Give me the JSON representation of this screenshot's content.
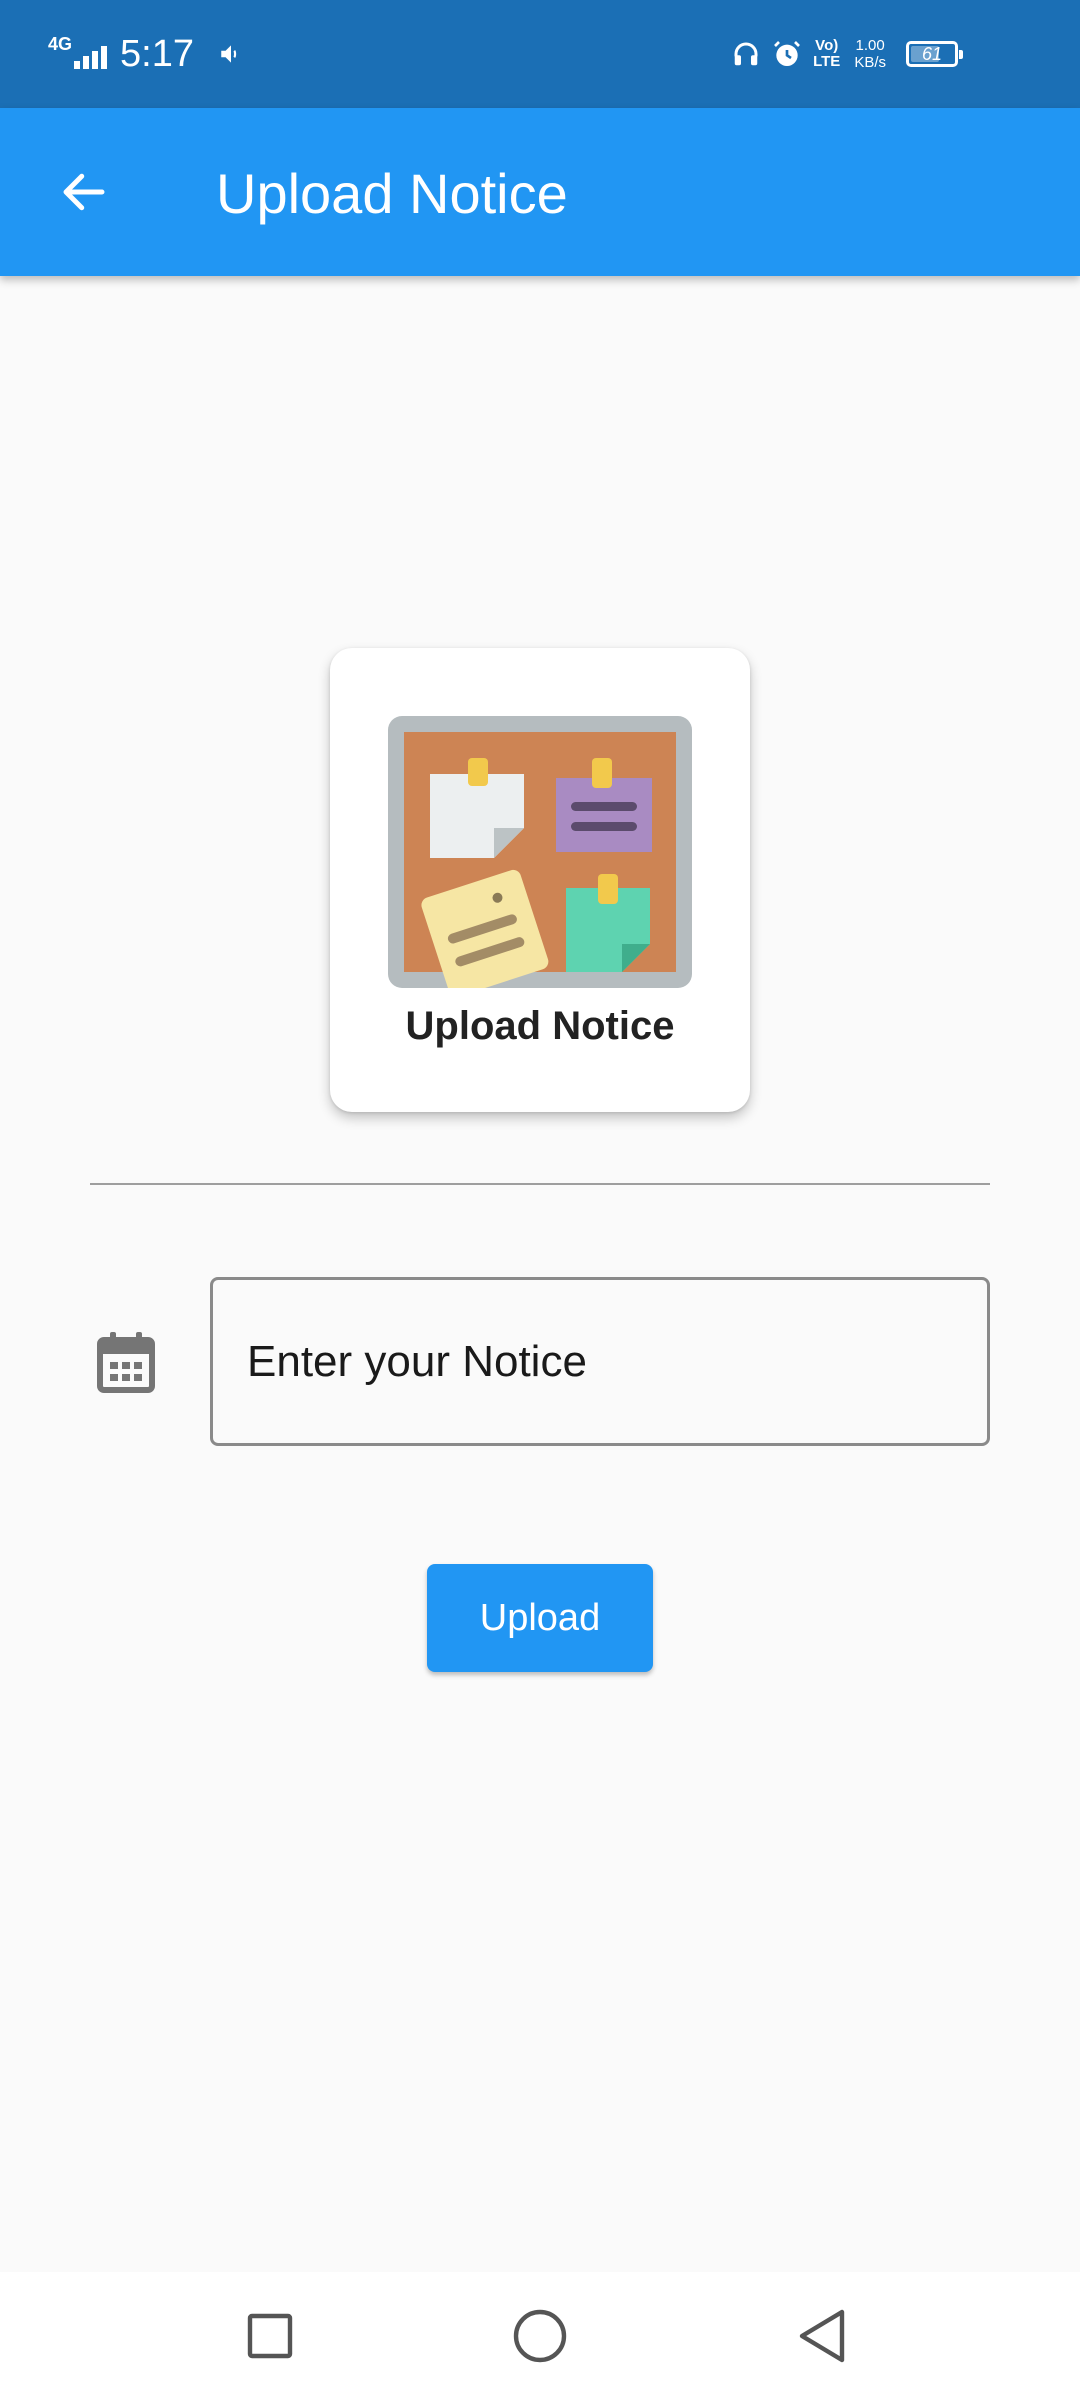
{
  "status_bar": {
    "network_type": "4G",
    "time": "5:17",
    "volte_line1": "Vo)",
    "volte_line2": "LTE",
    "speed_value": "1.00",
    "speed_unit": "KB/s",
    "battery_percent": "61",
    "battery_level": 0.61,
    "icons": [
      "signal-icon",
      "speaker-icon",
      "headphones-icon",
      "alarm-icon",
      "battery-icon"
    ]
  },
  "app_bar": {
    "title": "Upload Notice",
    "back_icon": "arrow-left-icon",
    "color": "#2196f3"
  },
  "card": {
    "title": "Upload Notice",
    "illustration": "notice-board-icon"
  },
  "form": {
    "date_icon": "calendar-icon",
    "notice_placeholder": "Enter your Notice",
    "notice_value": "",
    "upload_label": "Upload"
  },
  "nav_bar": {
    "icons": [
      "recents-square-icon",
      "home-circle-icon",
      "back-triangle-icon"
    ]
  },
  "colors": {
    "status_bar": "#1b6fb5",
    "primary": "#2196f3",
    "background": "#fafafa"
  }
}
